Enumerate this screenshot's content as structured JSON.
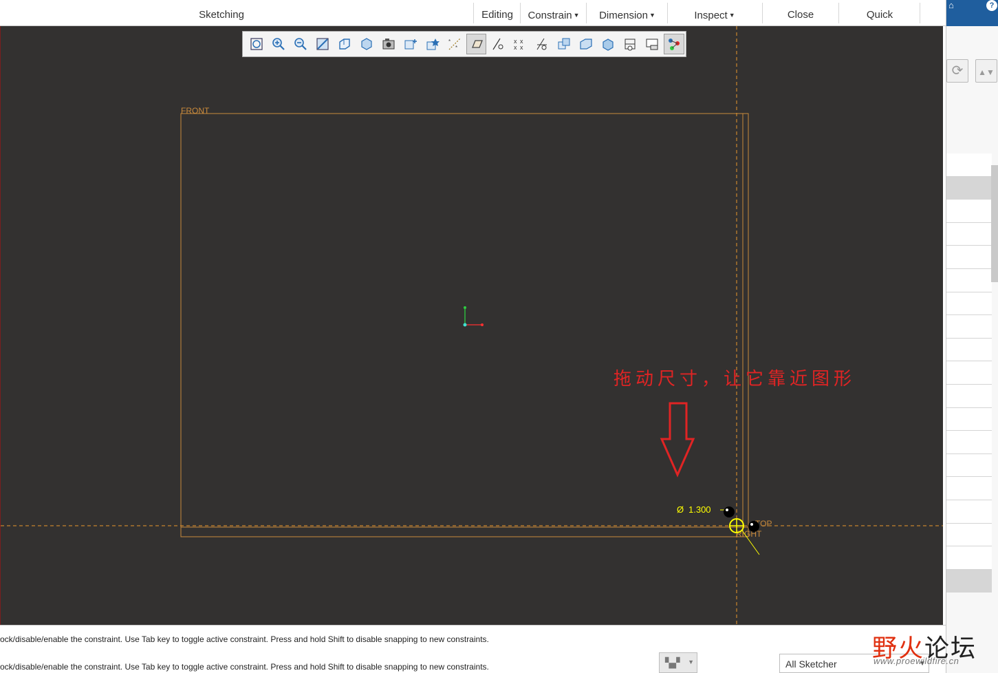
{
  "ribbon": {
    "tabs": [
      {
        "label": "Sketching",
        "dropdown": false
      },
      {
        "label": "Editing",
        "dropdown": false
      },
      {
        "label": "Constrain",
        "dropdown": true
      },
      {
        "label": "Dimension",
        "dropdown": true
      },
      {
        "label": "Inspect",
        "dropdown": true
      },
      {
        "label": "Close",
        "dropdown": false
      },
      {
        "label": "Quick",
        "dropdown": false
      }
    ]
  },
  "graphics_toolbar": {
    "icons": [
      "refit-icon",
      "zoom-in-icon",
      "zoom-out-icon",
      "repaint-icon",
      "display-style-icon",
      "saved-orientations-icon",
      "view-manager-icon",
      "appearance-icon",
      "spin-center-icon",
      "datum-display-filters-icon",
      "sketch-view-icon",
      "disp-dims-icon",
      "disp-constraints-icon",
      "disp-grid-icon",
      "disp-verts-icon",
      "shading-icon",
      "perspective-icon",
      "locked-dims-icon",
      "sketcher-display-icon",
      "annotation-display-icon"
    ],
    "active_icons": [
      "sketch-view-icon",
      "annotation-display-icon"
    ]
  },
  "sketch": {
    "plane_labels": {
      "front": "FRONT",
      "top": "TOP",
      "right": "RIGHT"
    },
    "dimension": {
      "symbol": "Ø",
      "value": "1.300"
    }
  },
  "annotation": {
    "text": "拖动尺寸，让它靠近图形",
    "color": "#e02424"
  },
  "messages": [
    "ock/disable/enable the constraint. Use Tab key to toggle active constraint. Press and hold Shift to disable snapping to new constraints.",
    "ock/disable/enable the constraint. Use Tab key to toggle active constraint. Press and hold Shift to disable snapping to new constraints."
  ],
  "filter": {
    "value": "All Sketcher"
  },
  "watermark": {
    "text_part1": "野火",
    "text_part2": "论坛",
    "url": "www.proewildfire.cn"
  },
  "colors": {
    "canvas_bg": "#333130",
    "datum_orange": "#c98a3c",
    "dimension_yellow": "#ffff00",
    "accent_blue": "#1f5e9e"
  }
}
